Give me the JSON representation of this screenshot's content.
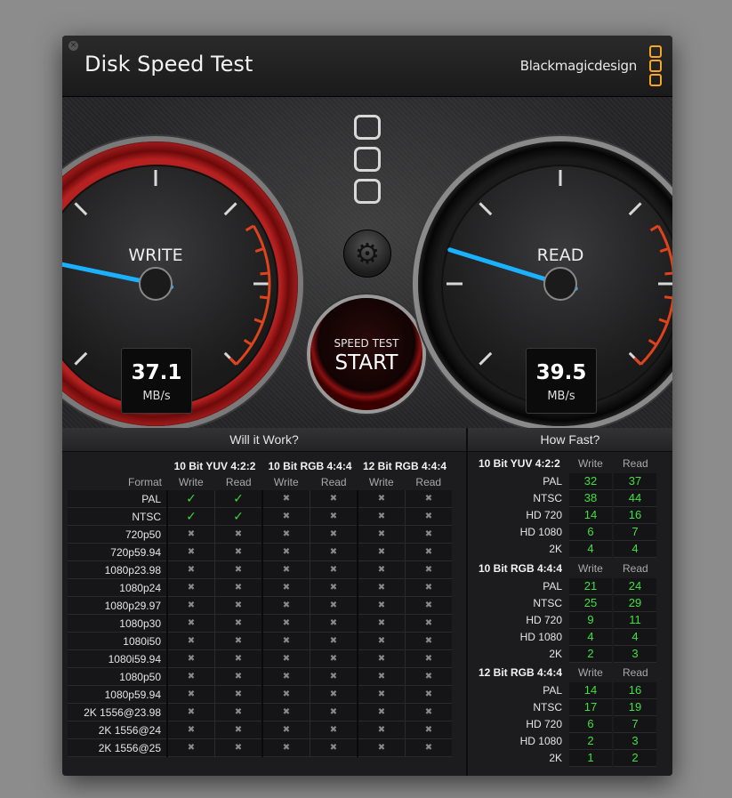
{
  "app": {
    "title": "Disk Speed Test",
    "brand": "Blackmagicdesign",
    "close_icon": "×"
  },
  "gauges": {
    "write": {
      "label": "WRITE",
      "value": "37.1",
      "unit": "MB/s",
      "needle_fraction": 0.21
    },
    "read": {
      "label": "READ",
      "value": "39.5",
      "unit": "MB/s",
      "needle_fraction": 0.23
    }
  },
  "controls": {
    "settings_icon": "gear-icon",
    "start_sub": "SPEED TEST",
    "start_main": "START"
  },
  "will_it_work": {
    "title": "Will it Work?",
    "format_label": "Format",
    "groups": [
      "10 Bit YUV 4:2:2",
      "10 Bit RGB 4:4:4",
      "12 Bit RGB 4:4:4"
    ],
    "write_label": "Write",
    "read_label": "Read",
    "ok_glyph": "✓",
    "no_glyph": "✖",
    "rows": [
      {
        "format": "PAL",
        "results": [
          true,
          true,
          false,
          false,
          false,
          false
        ]
      },
      {
        "format": "NTSC",
        "results": [
          true,
          true,
          false,
          false,
          false,
          false
        ]
      },
      {
        "format": "720p50",
        "results": [
          false,
          false,
          false,
          false,
          false,
          false
        ]
      },
      {
        "format": "720p59.94",
        "results": [
          false,
          false,
          false,
          false,
          false,
          false
        ]
      },
      {
        "format": "1080p23.98",
        "results": [
          false,
          false,
          false,
          false,
          false,
          false
        ]
      },
      {
        "format": "1080p24",
        "results": [
          false,
          false,
          false,
          false,
          false,
          false
        ]
      },
      {
        "format": "1080p29.97",
        "results": [
          false,
          false,
          false,
          false,
          false,
          false
        ]
      },
      {
        "format": "1080p30",
        "results": [
          false,
          false,
          false,
          false,
          false,
          false
        ]
      },
      {
        "format": "1080i50",
        "results": [
          false,
          false,
          false,
          false,
          false,
          false
        ]
      },
      {
        "format": "1080i59.94",
        "results": [
          false,
          false,
          false,
          false,
          false,
          false
        ]
      },
      {
        "format": "1080p50",
        "results": [
          false,
          false,
          false,
          false,
          false,
          false
        ]
      },
      {
        "format": "1080p59.94",
        "results": [
          false,
          false,
          false,
          false,
          false,
          false
        ]
      },
      {
        "format": "2K 1556@23.98",
        "results": [
          false,
          false,
          false,
          false,
          false,
          false
        ]
      },
      {
        "format": "2K 1556@24",
        "results": [
          false,
          false,
          false,
          false,
          false,
          false
        ]
      },
      {
        "format": "2K 1556@25",
        "results": [
          false,
          false,
          false,
          false,
          false,
          false
        ]
      }
    ]
  },
  "how_fast": {
    "title": "How Fast?",
    "write_label": "Write",
    "read_label": "Read",
    "groups": [
      {
        "name": "10 Bit YUV 4:2:2",
        "rows": [
          {
            "format": "PAL",
            "write": "32",
            "read": "37"
          },
          {
            "format": "NTSC",
            "write": "38",
            "read": "44"
          },
          {
            "format": "HD 720",
            "write": "14",
            "read": "16"
          },
          {
            "format": "HD 1080",
            "write": "6",
            "read": "7"
          },
          {
            "format": "2K",
            "write": "4",
            "read": "4"
          }
        ]
      },
      {
        "name": "10 Bit RGB 4:4:4",
        "rows": [
          {
            "format": "PAL",
            "write": "21",
            "read": "24"
          },
          {
            "format": "NTSC",
            "write": "25",
            "read": "29"
          },
          {
            "format": "HD 720",
            "write": "9",
            "read": "11"
          },
          {
            "format": "HD 1080",
            "write": "4",
            "read": "4"
          },
          {
            "format": "2K",
            "write": "2",
            "read": "3"
          }
        ]
      },
      {
        "name": "12 Bit RGB 4:4:4",
        "rows": [
          {
            "format": "PAL",
            "write": "14",
            "read": "16"
          },
          {
            "format": "NTSC",
            "write": "17",
            "read": "19"
          },
          {
            "format": "HD 720",
            "write": "6",
            "read": "7"
          },
          {
            "format": "HD 1080",
            "write": "2",
            "read": "3"
          },
          {
            "format": "2K",
            "write": "1",
            "read": "2"
          }
        ]
      }
    ]
  }
}
